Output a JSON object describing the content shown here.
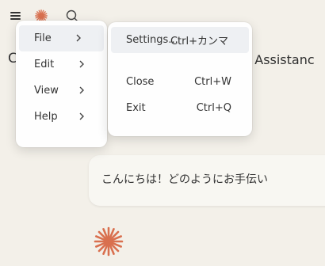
{
  "toolbar": {
    "menu_icon": "hamburger-icon",
    "logo_icon": "starburst-logo-icon",
    "search_icon": "search-icon"
  },
  "header": {
    "title_left": "C",
    "title_right": "d Assistanc"
  },
  "main_menu": {
    "items": [
      {
        "label": "File"
      },
      {
        "label": "Edit"
      },
      {
        "label": "View"
      },
      {
        "label": "Help"
      }
    ]
  },
  "file_submenu": {
    "items": [
      {
        "label": "Settings...",
        "shortcut": "Ctrl+カンマ"
      },
      {
        "label": "Close",
        "shortcut": "Ctrl+W"
      },
      {
        "label": "Exit",
        "shortcut": "Ctrl+Q"
      }
    ]
  },
  "chat": {
    "message": "こんにちは！どのようにお手伝い"
  },
  "colors": {
    "background": "#f3f0e9",
    "accent": "#d9704f",
    "menu_bg": "#fefefe",
    "hover_bg": "#eef0f3"
  }
}
